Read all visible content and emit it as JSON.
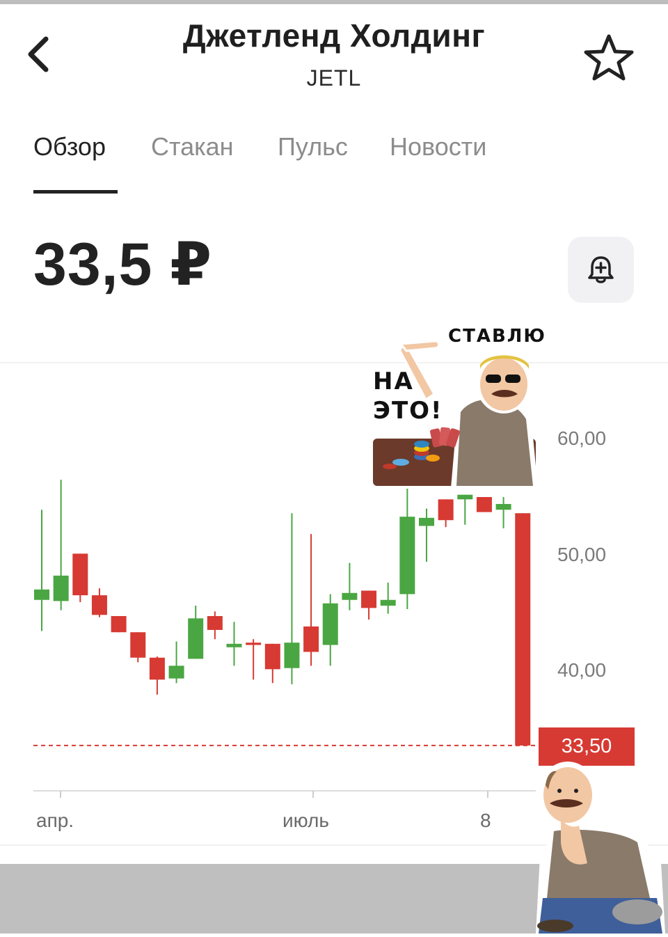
{
  "header": {
    "title": "Джетленд Холдинг",
    "ticker": "JETL"
  },
  "tabs": [
    {
      "label": "Обзор",
      "active": true
    },
    {
      "label": "Стакан",
      "active": false
    },
    {
      "label": "Пульс",
      "active": false
    },
    {
      "label": "Новости",
      "active": false
    }
  ],
  "price": {
    "value": "33,5 ₽"
  },
  "icons": {
    "back": "chevron-left-icon",
    "favorite": "star-outline-icon",
    "alert": "bell-plus-icon"
  },
  "colors": {
    "up": "#4aa642",
    "down": "#d63a33",
    "accent_red": "#d63a33"
  },
  "sticker_top": {
    "line1": "СТАВЛЮ",
    "line2": "НА",
    "line3": "ЭТО!"
  },
  "chart_data": {
    "type": "candlestick",
    "current_price_label": "33,50",
    "current_price": 33.5,
    "y_tick_labels": [
      "60,00",
      "50,00",
      "40,00"
    ],
    "y_ticks": [
      60,
      50,
      40
    ],
    "x_tick_labels": [
      "апр.",
      "июль",
      "8"
    ],
    "ylim": [
      29.8,
      65
    ],
    "candles": [
      {
        "o": 46.1,
        "c": 47.0,
        "h": 53.9,
        "l": 43.4
      },
      {
        "o": 46.0,
        "c": 48.2,
        "h": 56.5,
        "l": 45.2
      },
      {
        "o": 50.1,
        "c": 46.5,
        "h": 50.1,
        "l": 45.9
      },
      {
        "o": 46.5,
        "c": 44.8,
        "h": 47.1,
        "l": 44.6
      },
      {
        "o": 44.7,
        "c": 43.3,
        "h": 44.7,
        "l": 43.3
      },
      {
        "o": 43.3,
        "c": 41.1,
        "h": 43.3,
        "l": 40.7
      },
      {
        "o": 41.1,
        "c": 39.2,
        "h": 41.2,
        "l": 37.9
      },
      {
        "o": 39.3,
        "c": 40.4,
        "h": 42.5,
        "l": 38.9
      },
      {
        "o": 41.0,
        "c": 44.5,
        "h": 45.6,
        "l": 41.0
      },
      {
        "o": 44.7,
        "c": 43.5,
        "h": 45.1,
        "l": 42.7
      },
      {
        "o": 42.0,
        "c": 42.3,
        "h": 44.2,
        "l": 40.4
      },
      {
        "o": 42.4,
        "c": 42.2,
        "h": 42.7,
        "l": 39.2
      },
      {
        "o": 42.3,
        "c": 40.1,
        "h": 42.3,
        "l": 38.9
      },
      {
        "o": 40.2,
        "c": 42.4,
        "h": 53.6,
        "l": 38.8
      },
      {
        "o": 43.8,
        "c": 41.6,
        "h": 51.8,
        "l": 40.4
      },
      {
        "o": 42.2,
        "c": 45.8,
        "h": 46.6,
        "l": 40.4
      },
      {
        "o": 46.1,
        "c": 46.7,
        "h": 49.3,
        "l": 45.2
      },
      {
        "o": 46.9,
        "c": 45.4,
        "h": 46.9,
        "l": 44.4
      },
      {
        "o": 45.6,
        "c": 46.1,
        "h": 47.6,
        "l": 44.9
      },
      {
        "o": 46.6,
        "c": 53.3,
        "h": 55.8,
        "l": 45.3
      },
      {
        "o": 52.5,
        "c": 53.2,
        "h": 54.0,
        "l": 49.4
      },
      {
        "o": 54.8,
        "c": 53.0,
        "h": 54.8,
        "l": 52.4
      },
      {
        "o": 54.8,
        "c": 55.2,
        "h": 55.2,
        "l": 52.6
      },
      {
        "o": 55.0,
        "c": 53.7,
        "h": 55.0,
        "l": 53.7
      },
      {
        "o": 53.9,
        "c": 54.4,
        "h": 55.0,
        "l": 52.3
      },
      {
        "o": 53.6,
        "c": 33.5,
        "h": 53.6,
        "l": 33.5
      }
    ]
  }
}
